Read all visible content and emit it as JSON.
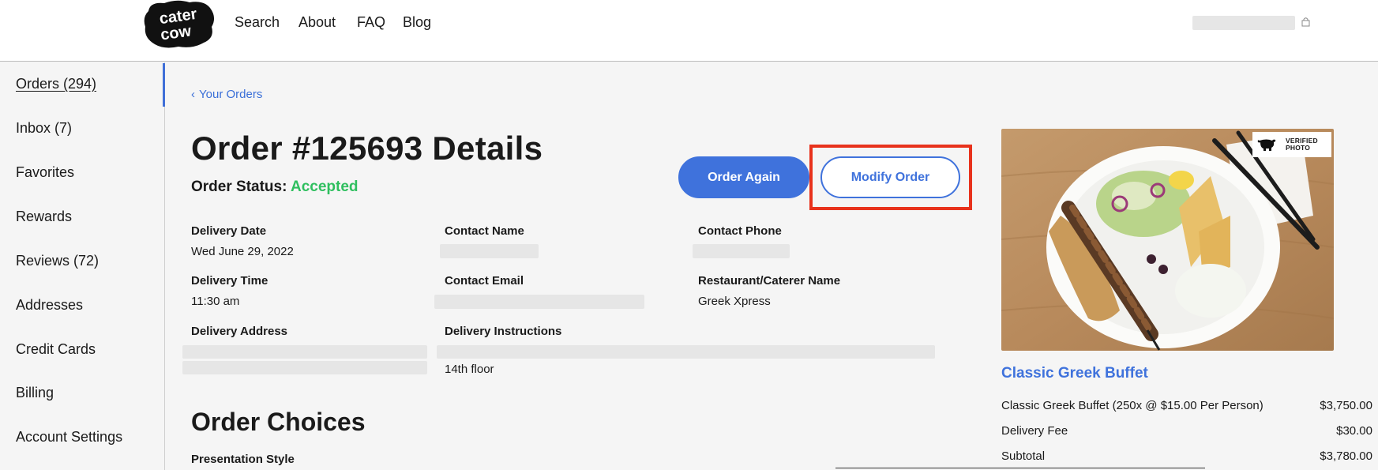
{
  "brand": {
    "logo_line1": "cater",
    "logo_line2": "cow"
  },
  "nav": {
    "search": "Search",
    "about": "About",
    "faq": "FAQ",
    "blog": "Blog"
  },
  "sidebar": {
    "items": [
      {
        "label": "Orders (294)"
      },
      {
        "label": "Inbox (7)"
      },
      {
        "label": "Favorites"
      },
      {
        "label": "Rewards"
      },
      {
        "label": "Reviews (72)"
      },
      {
        "label": "Addresses"
      },
      {
        "label": "Credit Cards"
      },
      {
        "label": "Billing"
      },
      {
        "label": "Account Settings"
      }
    ]
  },
  "breadcrumb": {
    "back_label": "Your Orders",
    "chevron": "‹"
  },
  "order": {
    "title": "Order #125693 Details",
    "status_label": "Order Status:",
    "status_value": "Accepted"
  },
  "actions": {
    "order_again": "Order Again",
    "modify_order": "Modify Order"
  },
  "details": {
    "delivery_date_label": "Delivery Date",
    "delivery_date_value": "Wed June 29, 2022",
    "contact_name_label": "Contact Name",
    "contact_phone_label": "Contact Phone",
    "delivery_time_label": "Delivery Time",
    "delivery_time_value": "11:30 am",
    "contact_email_label": "Contact Email",
    "restaurant_label": "Restaurant/Caterer Name",
    "restaurant_value": "Greek Xpress",
    "delivery_address_label": "Delivery Address",
    "delivery_instructions_label": "Delivery Instructions",
    "delivery_instructions_value": "14th floor"
  },
  "choices": {
    "title": "Order Choices",
    "presentation_style_label": "Presentation Style"
  },
  "summary": {
    "verified_line1": "VERIFIED",
    "verified_line2": "PHOTO",
    "caterer_link": "Classic Greek Buffet",
    "lines": [
      {
        "label": "Classic Greek Buffet (250x @ $15.00 Per Person)",
        "amount": "$3,750.00"
      },
      {
        "label": "Delivery Fee",
        "amount": "$30.00"
      },
      {
        "label": "Subtotal",
        "amount": "$3,780.00"
      }
    ]
  },
  "colors": {
    "accent": "#3f72dc",
    "status_green": "#2fbf5f",
    "highlight_red": "#e8321c"
  }
}
